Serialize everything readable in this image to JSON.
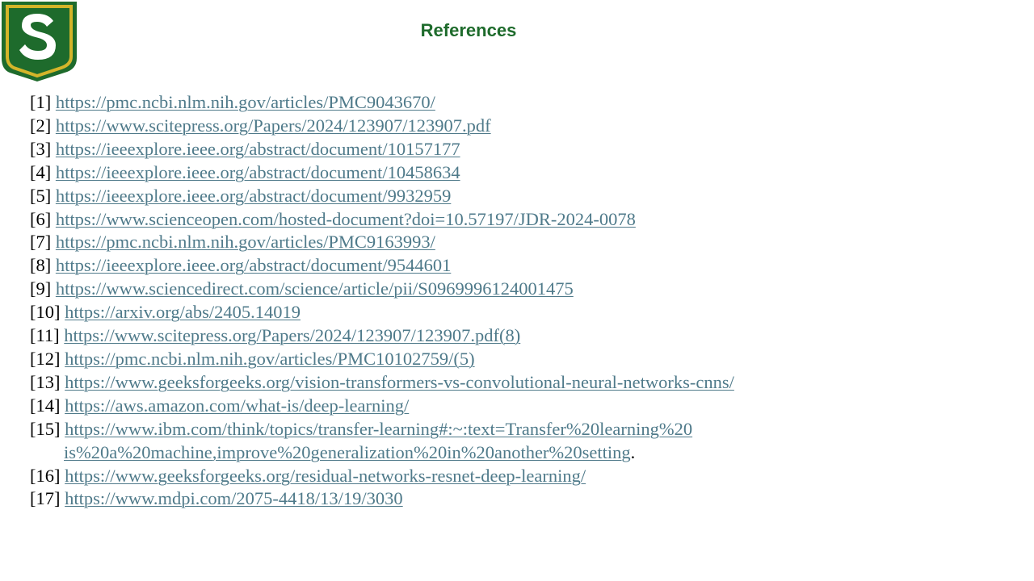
{
  "page": {
    "title": "References",
    "colors": {
      "title": "#1e6b2c",
      "link": "#4f7a8a",
      "shield_green": "#1e6b2c",
      "shield_gold": "#d4b52a"
    }
  },
  "logo": {
    "letter": "S",
    "icon": "shield-s-logo"
  },
  "references": [
    {
      "num": "[1]",
      "url": "https://pmc.ncbi.nlm.nih.gov/articles/PMC9043670/"
    },
    {
      "num": "[2]",
      "url": "https://www.scitepress.org/Papers/2024/123907/123907.pdf"
    },
    {
      "num": "[3]",
      "url": "https://ieeexplore.ieee.org/abstract/document/10157177"
    },
    {
      "num": "[4]",
      "url": "https://ieeexplore.ieee.org/abstract/document/10458634"
    },
    {
      "num": "[5]",
      "url": "https://ieeexplore.ieee.org/abstract/document/9932959"
    },
    {
      "num": "[6]",
      "url": "https://www.scienceopen.com/hosted-document?doi=10.57197/JDR-2024-0078"
    },
    {
      "num": "[7]",
      "url": "https://pmc.ncbi.nlm.nih.gov/articles/PMC9163993/"
    },
    {
      "num": "[8]",
      "url": "https://ieeexplore.ieee.org/abstract/document/9544601"
    },
    {
      "num": "[9]",
      "url": "https://www.sciencedirect.com/science/article/pii/S0969996124001475"
    },
    {
      "num": "[10]",
      "url": "https://arxiv.org/abs/2405.14019"
    },
    {
      "num": "[11]",
      "url": "https://www.scitepress.org/Papers/2024/123907/123907.pdf(8)"
    },
    {
      "num": "[12]",
      "url": "https://pmc.ncbi.nlm.nih.gov/articles/PMC10102759/(5)"
    },
    {
      "num": "[13]",
      "url": "https://www.geeksforgeeks.org/vision-transformers-vs-convolutional-neural-networks-cnns/"
    },
    {
      "num": "[14]",
      "url": "https://aws.amazon.com/what-is/deep-learning/"
    },
    {
      "num": "[15]",
      "url_line1": "https://www.ibm.com/think/topics/transfer-learning#:~:text=Transfer%20learning%20",
      "url_line2": "is%20a%20machine,improve%20generalization%20in%20another%20setting",
      "suffix": "."
    },
    {
      "num": "[16]",
      "url": "https://www.geeksforgeeks.org/residual-networks-resnet-deep-learning/"
    },
    {
      "num": "[17]",
      "url": "https://www.mdpi.com/2075-4418/13/19/3030"
    }
  ]
}
